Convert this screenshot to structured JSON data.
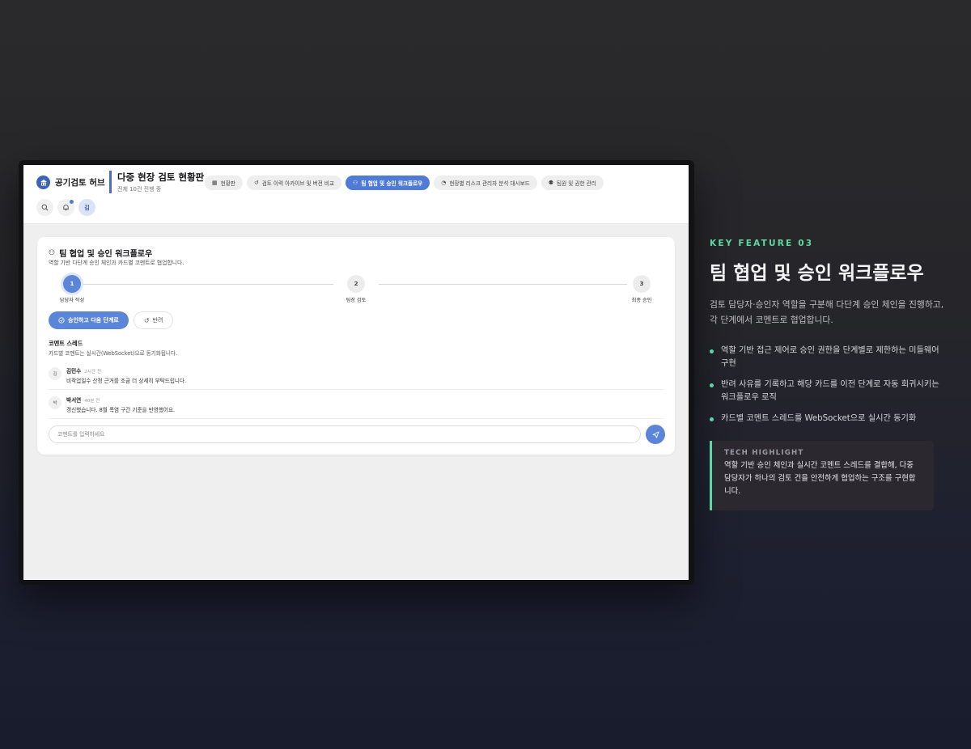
{
  "app": {
    "brand": "공기검토 허브",
    "title": "다중 현장 검토 현황판",
    "subtitle": "전체 10건 진행 중",
    "tabs": [
      {
        "label": "현황판",
        "icon": "grid-icon"
      },
      {
        "label": "검토 이력 아카이브 및 버전 비교",
        "icon": "history-icon"
      },
      {
        "label": "팀 협업 및 승인 워크플로우",
        "icon": "users-icon",
        "active": true
      },
      {
        "label": "현장별 리스크 관리자 분석 대시보드",
        "icon": "chart-icon"
      },
      {
        "label": "팀원 및 권한 관리",
        "icon": "team-icon"
      }
    ],
    "avatar_initial": "김",
    "notification_dot": true,
    "accent": "#4f7bd6"
  },
  "workflow": {
    "title": "팀 협업 및 승인 워크플로우",
    "subtitle": "역할 기반 다단계 승인 체인과 카드별 코멘트로 협업합니다.",
    "steps": [
      {
        "number": "1",
        "label": "담당자 작성",
        "active": true
      },
      {
        "number": "2",
        "label": "팀장 검토",
        "active": false
      },
      {
        "number": "3",
        "label": "최종 승인",
        "active": false
      }
    ],
    "approve_label": "승인하고 다음 단계로",
    "reject_label": "반려"
  },
  "thread": {
    "title": "코멘트 스레드",
    "subtitle": "카드별 코멘트는 실시간(WebSocket)으로 동기화됩니다.",
    "comments": [
      {
        "initial": "김",
        "name": "김민수",
        "time": "2시간 전",
        "text": "비작업일수 산정 근거를 조금 더 상세히 부탁드립니다."
      },
      {
        "initial": "박",
        "name": "박서연",
        "time": "40분 전",
        "text": "갱신했습니다. 8월 폭염 구간 기준을 반영했어요."
      }
    ],
    "input_placeholder": "코멘트를 입력하세요"
  },
  "feature": {
    "label": "KEY FEATURE 03",
    "title": "팀 협업 및 승인 워크플로우",
    "description": "검토 담당자·승인자 역할을 구분해 다단계 승인 체인을 진행하고, 각 단계에서 코멘트로 협업합니다.",
    "bullets": [
      "역할 기반 접근 제어로 승인 권한을 단계별로 제한하는 미들웨어 구현",
      "반려 사유를 기록하고 해당 카드를 이전 단계로 자동 회귀시키는 워크플로우 로직",
      "카드별 코멘트 스레드를 WebSocket으로 실시간 동기화"
    ],
    "tech_label": "TECH HIGHLIGHT",
    "tech_text": "역할 기반 승인 체인과 실시간 코멘트 스레드를 결합해, 다중 담당자가 하나의 검토 건을 안전하게 협업하는 구조를 구현합니다.",
    "accent": "#5fd7a3"
  }
}
